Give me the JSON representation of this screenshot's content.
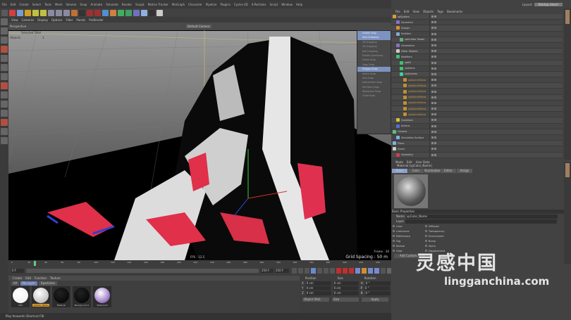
{
  "menu": [
    "File",
    "Edit",
    "Create",
    "Select",
    "Tools",
    "Mesh",
    "Volume",
    "Snap",
    "Animate",
    "Simulate",
    "Render",
    "Sculpt",
    "Motion Tracker",
    "MoGraph",
    "Character",
    "Pipeline",
    "Plugins",
    "Cycles 4D",
    "X-Particles",
    "Script",
    "Window",
    "Help"
  ],
  "viewport": {
    "menu": [
      "View",
      "Cameras",
      "Display",
      "Options",
      "Filter",
      "Panels",
      "ProRender"
    ],
    "name": "Perspective",
    "camera": "Default Camera",
    "selected_label": "Selected Total",
    "objects_label": "Objects",
    "objects_count": "1",
    "frame": "Frame : 30",
    "grid": "Grid Spacing : 50 m",
    "fps": "FPS : 12.5"
  },
  "snap_menu": [
    {
      "label": "Enable Snap",
      "on": true
    },
    {
      "label": "Auto Snapping",
      "on": true
    },
    {
      "label": "3D Snapping"
    },
    {
      "label": "2D Snapping"
    },
    {
      "label": "Dot Snapping"
    },
    {
      "label": "Enable Quantizing"
    },
    {
      "label": "Vertex Snap"
    },
    {
      "label": "Edge Snap"
    },
    {
      "label": "Polygon Snap",
      "on": true
    },
    {
      "label": "Spline Snap"
    },
    {
      "label": "Axis Snap"
    },
    {
      "label": "Intersection Snap"
    },
    {
      "label": "Mid Point Snap"
    },
    {
      "label": "Workplane Snap"
    },
    {
      "label": "Guide Snap"
    }
  ],
  "layout": {
    "label": "Layout:",
    "value": "Startup (User)"
  },
  "object_manager": {
    "menu": [
      "File",
      "Edit",
      "View",
      "Objects",
      "Tags",
      "Bookmarks"
    ],
    "items": [
      {
        "name": "xpSystem",
        "color": "#d8a030",
        "depth": 0
      },
      {
        "name": "Dynamics",
        "color": "#8a70c8",
        "depth": 1
      },
      {
        "name": "Groups",
        "color": "#d89030",
        "depth": 1
      },
      {
        "name": "Emitters",
        "color": "#80a8d0",
        "depth": 1
      },
      {
        "name": "xpEmitter Model",
        "color": "#60b080",
        "depth": 2
      },
      {
        "name": "Generators",
        "color": "#8a70c8",
        "depth": 1
      },
      {
        "name": "Other Objects",
        "color": "#cccccc",
        "depth": 1
      },
      {
        "name": "Modifiers",
        "color": "#40c070",
        "depth": 1
      },
      {
        "name": "xpKill",
        "color": "#40c070",
        "depth": 2
      },
      {
        "name": "xpSpline",
        "color": "#40c070",
        "depth": 2
      },
      {
        "name": "xpSpheres",
        "color": "#40d0a0",
        "depth": 2
      },
      {
        "name": "xpSplineFollow",
        "color": "#c09030",
        "depth": 3
      },
      {
        "name": "xpSplineFollow",
        "color": "#c09030",
        "depth": 3
      },
      {
        "name": "xpSplineFollow",
        "color": "#c09030",
        "depth": 3
      },
      {
        "name": "xpSplineFollow",
        "color": "#c09030",
        "depth": 3
      },
      {
        "name": "xpSplineFollow",
        "color": "#c09030",
        "depth": 3
      },
      {
        "name": "xpSplineFollow",
        "color": "#c09030",
        "depth": 3
      },
      {
        "name": "xpSplineFollow",
        "color": "#c09030",
        "depth": 3
      },
      {
        "name": "Questions",
        "color": "#d0c040",
        "depth": 1
      },
      {
        "name": "Actions",
        "color": "#5070d0",
        "depth": 1
      },
      {
        "name": "Camera",
        "color": "#60c080",
        "depth": 0
      },
      {
        "name": "Simulation Surface",
        "color": "#80b0e0",
        "depth": 1
      },
      {
        "name": "Plane",
        "color": "#80b0e0",
        "depth": 0
      },
      {
        "name": "Scene",
        "color": "#cccccc",
        "depth": 0
      },
      {
        "name": "Geometry",
        "color": "#d04050",
        "depth": 1
      }
    ]
  },
  "attributes": {
    "menu": [
      "Mode",
      "Edit",
      "User Data"
    ],
    "title": "Material [xpColor_Name]",
    "tabs": [
      "Basic",
      "Color",
      "Illumination",
      "Editor",
      "Assign"
    ],
    "section": "Basic Properties",
    "name_label": "Name",
    "name_value": "xpColor_Name",
    "layer_label": "Layer",
    "left_channels": [
      "Color",
      "Luminance",
      "Reflectance",
      "Fog",
      "Normal",
      "Glow"
    ],
    "right_channels": [
      "Diffusion",
      "Transparency",
      "Environment",
      "Bump",
      "Alpha",
      "Displacement"
    ],
    "add_button": "Add Custom..."
  },
  "timeline": {
    "ticks": [
      "0",
      "20",
      "40",
      "60",
      "80",
      "100",
      "120",
      "140",
      "160",
      "180",
      "200",
      "220",
      "240",
      "260",
      "280",
      "300",
      "320",
      "340",
      "360",
      "380",
      "400",
      "420",
      "440"
    ],
    "start": "0 F",
    "end": "250 F",
    "end2": "250 F",
    "playhead": 0.06
  },
  "materials": {
    "menu": [
      "Create",
      "Edit",
      "Function",
      "Texture"
    ],
    "filters": [
      "All",
      "No Layer",
      "Xparticles"
    ],
    "items": [
      {
        "name": "Mat",
        "color": "#eeeeee"
      },
      {
        "name": "xpColor_Name",
        "color": "#aaaaaa",
        "selected": true
      },
      {
        "name": "Material",
        "color": "#000000"
      },
      {
        "name": "Background.1",
        "color": "#000000"
      },
      {
        "name": "Material.8",
        "color": "#6a3aa8"
      }
    ]
  },
  "coordinates": {
    "headers": [
      "Position",
      "Size",
      "Rotation"
    ],
    "rows": [
      {
        "axis": "X",
        "pos": "0 cm",
        "size": "0 cm",
        "rax": "H",
        "rot": "0 °"
      },
      {
        "axis": "Y",
        "pos": "0 cm",
        "size": "0 cm",
        "rax": "P",
        "rot": "0 °"
      },
      {
        "axis": "Z",
        "pos": "0 cm",
        "size": "0 cm",
        "rax": "B",
        "rot": "0 °"
      }
    ],
    "mode": "Object (Rel)",
    "size_mode": "Size",
    "apply": "Apply"
  },
  "status": "Play forwards (Shortcut F8)",
  "watermark": {
    "cn": "灵感中国",
    "en": "lingganchina.com"
  }
}
